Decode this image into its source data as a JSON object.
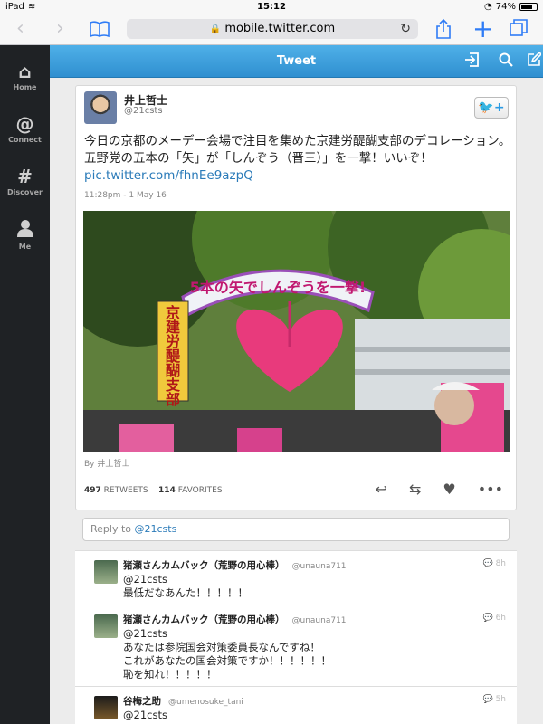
{
  "status_bar": {
    "device": "iPad",
    "time": "15:12",
    "battery": "74%",
    "battery_level": 0.74
  },
  "browser": {
    "url": "mobile.twitter.com"
  },
  "sidebar": {
    "items": [
      {
        "label": "Home",
        "icon": "home-icon"
      },
      {
        "label": "Connect",
        "icon": "at-icon"
      },
      {
        "label": "Discover",
        "icon": "hash-icon"
      },
      {
        "label": "Me",
        "icon": "person-icon"
      }
    ]
  },
  "appbar": {
    "title": "Tweet"
  },
  "tweet": {
    "author_name": "井上哲士",
    "author_handle": "@21csts",
    "text": "今日の京都のメーデー会場で注目を集めた京建労醍醐支部のデコレーション。五野党の五本の「矢」が「しんぞう（晋三）」を一撃！いいぞ！",
    "link": "pic.twitter.com/fhnEe9azpQ",
    "timestamp": "11:28pm - 1 May 16",
    "photo_by": "By 井上哲士",
    "photo_banner_text": "5本の矢でしんぞうを一撃!",
    "photo_sign_text": "京建労醍醐支部",
    "retweets": "497",
    "retweets_label": "RETWEETS",
    "favorites": "114",
    "favorites_label": "FAVORITES"
  },
  "reply_box": {
    "placeholder_prefix": "Reply to ",
    "placeholder_mention": "@21csts"
  },
  "replies": [
    {
      "name": "猪瀬さんカムバック（荒野の用心棒）",
      "handle": "@unauna711",
      "time": "8h",
      "lines": [
        "@21csts",
        "最低だなあんた！！！！！"
      ]
    },
    {
      "name": "猪瀬さんカムバック（荒野の用心棒）",
      "handle": "@unauna711",
      "time": "6h",
      "lines": [
        "@21csts",
        "あなたは参院国会対策委員長なんですね！",
        "これがあなたの国会対策ですか！！！！！！",
        "恥を知れ！！！！！"
      ]
    },
    {
      "name": "谷梅之助",
      "handle": "@umenosuke_tani",
      "time": "5h",
      "lines": [
        "@21csts"
      ]
    }
  ]
}
